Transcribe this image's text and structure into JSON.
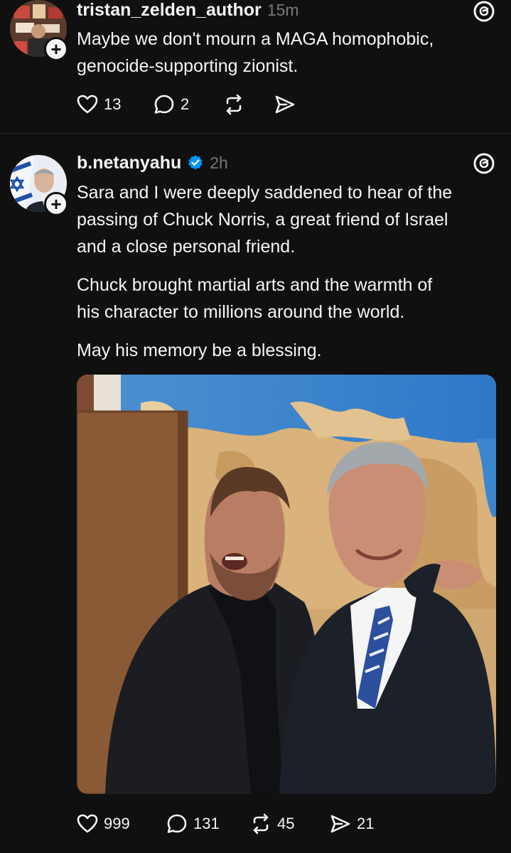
{
  "post1": {
    "username": "tristan_zelden_author",
    "time": "15m",
    "text_line1": "Maybe we don't mourn a MAGA homophobic,",
    "text_line2": "genocide-supporting zionist.",
    "likes": "13",
    "replies": "2",
    "reposts": "",
    "shares": ""
  },
  "post2": {
    "username": "b.netanyahu",
    "time": "2h",
    "paragraph1_line1": "Sara and I were deeply saddened to hear of the",
    "paragraph1_line2": "passing of Chuck Norris, a great friend of Israel",
    "paragraph1_line3": "and a close personal friend.",
    "paragraph2_line1": "Chuck brought martial arts and the warmth of",
    "paragraph2_line2": "his character to millions around the world.",
    "paragraph3": "May his memory be a blessing.",
    "likes": "999",
    "replies": "131",
    "reposts": "45",
    "shares": "21"
  },
  "colors": {
    "background": "#101010",
    "text": "#f3f5f7",
    "muted": "#777777",
    "verified": "#0095f6"
  },
  "icons": [
    "heart-icon",
    "comment-icon",
    "repost-icon",
    "share-icon",
    "threads-icon",
    "verified-icon",
    "plus-icon"
  ]
}
